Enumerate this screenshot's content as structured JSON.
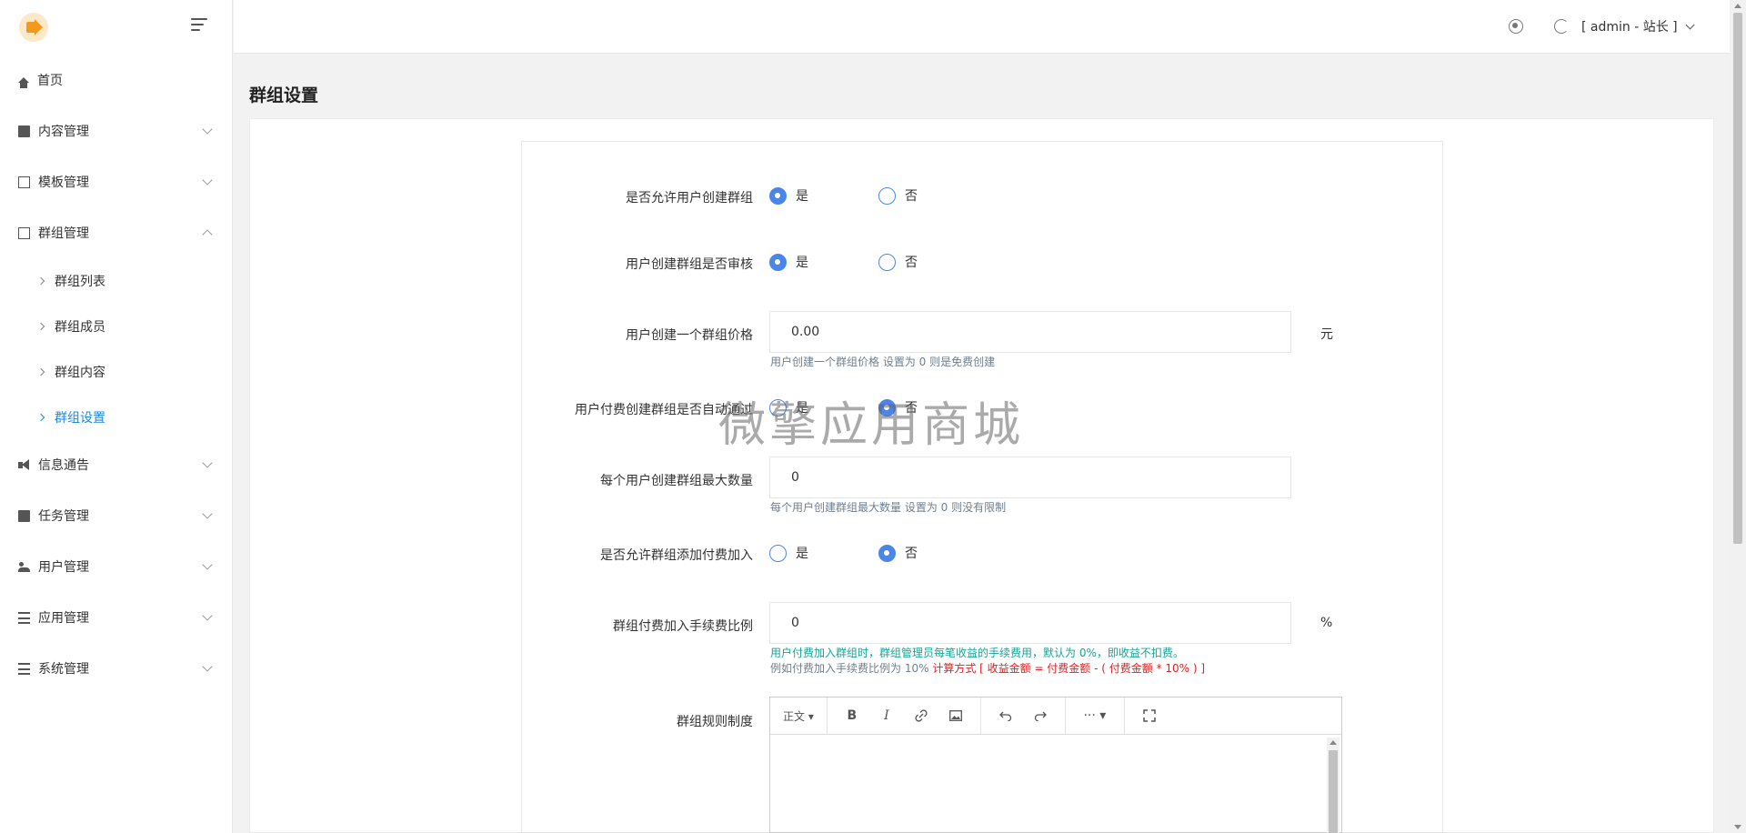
{
  "header": {
    "user_label": "[ admin - 站长 ]"
  },
  "sidebar": {
    "items": [
      {
        "label": "首页",
        "icon": "home-icon"
      },
      {
        "label": "内容管理",
        "icon": "message-icon"
      },
      {
        "label": "模板管理",
        "icon": "template-icon"
      },
      {
        "label": "群组管理",
        "icon": "group-icon",
        "expanded": true
      },
      {
        "label": "信息通告",
        "icon": "notice-icon"
      },
      {
        "label": "任务管理",
        "icon": "task-icon"
      },
      {
        "label": "用户管理",
        "icon": "users-icon"
      },
      {
        "label": "应用管理",
        "icon": "apps-icon"
      },
      {
        "label": "系统管理",
        "icon": "system-icon"
      }
    ],
    "sub_items": [
      {
        "label": "群组列表"
      },
      {
        "label": "群组成员"
      },
      {
        "label": "群组内容"
      },
      {
        "label": "群组设置",
        "active": true
      }
    ]
  },
  "page": {
    "title": "群组设置"
  },
  "form": {
    "yes_label": "是",
    "no_label": "否",
    "allow_create": {
      "label": "是否允许用户创建群组",
      "selected": "是"
    },
    "create_review": {
      "label": "用户创建群组是否审核",
      "selected": "是"
    },
    "create_price": {
      "label": "用户创建一个群组价格",
      "value": "0.00",
      "suffix": "元",
      "hint": "用户创建一个群组价格 设置为 0 则是免费创建"
    },
    "auto_pass": {
      "label": "用户付费创建群组是否自动通过",
      "selected": "否"
    },
    "max_count": {
      "label": "每个用户创建群组最大数量",
      "value": "0",
      "hint": "每个用户创建群组最大数量 设置为 0 则没有限制"
    },
    "allow_paid_join": {
      "label": "是否允许群组添加付费加入",
      "selected": "否"
    },
    "fee_ratio": {
      "label": "群组付费加入手续费比例",
      "value": "0",
      "suffix": "%",
      "hint1": "用户付费加入群组时，群组管理员每笔收益的手续费用，默认为 0%，即收益不扣费。",
      "hint2_prefix": "例如付费加入手续费比例为 10% ",
      "hint2_red": "计算方式 [ 收益金额 = 付费金额 - ( 付费金额 * 10% ) ]"
    },
    "rules": {
      "label": "群组规则制度",
      "para_label": "正文",
      "more_label": "···"
    }
  },
  "watermark": "微擎应用商城",
  "colors": {
    "primary": "#4a86e8",
    "active_menu": "#1e88e5",
    "hint_teal": "#16a596",
    "hint_red": "#e02020"
  }
}
